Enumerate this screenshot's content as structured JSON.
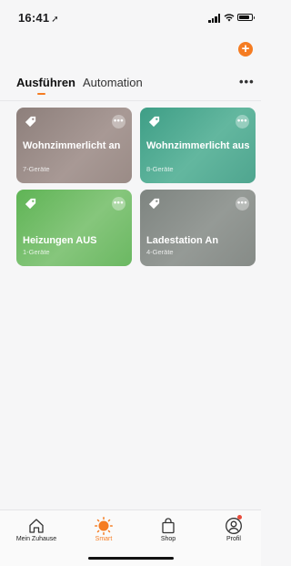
{
  "status_bar": {
    "time": "16:41"
  },
  "tabs": [
    {
      "label": "Ausführen",
      "active": true
    },
    {
      "label": "Automation",
      "active": false
    }
  ],
  "scenes": [
    {
      "name": "Wohnzimmerlicht an",
      "devices": "7-Geräte",
      "color": "#a09190"
    },
    {
      "name": "Wohnzimmerlicht aus",
      "devices": "8-Geräte",
      "color": "#57ad96"
    },
    {
      "name": "Heizungen AUS",
      "devices": "1-Geräte",
      "color": "#78c06e"
    },
    {
      "name": "Ladestation An",
      "devices": "4-Geräte",
      "color": "#8c918d"
    }
  ],
  "bottom_nav": [
    {
      "label": "Mein Zuhause",
      "icon": "home-icon"
    },
    {
      "label": "Smart",
      "icon": "sun-icon",
      "active": true
    },
    {
      "label": "Shop",
      "icon": "shopping-bag-icon"
    },
    {
      "label": "Profil",
      "icon": "profile-icon"
    }
  ],
  "accent_color": "#f57c22"
}
